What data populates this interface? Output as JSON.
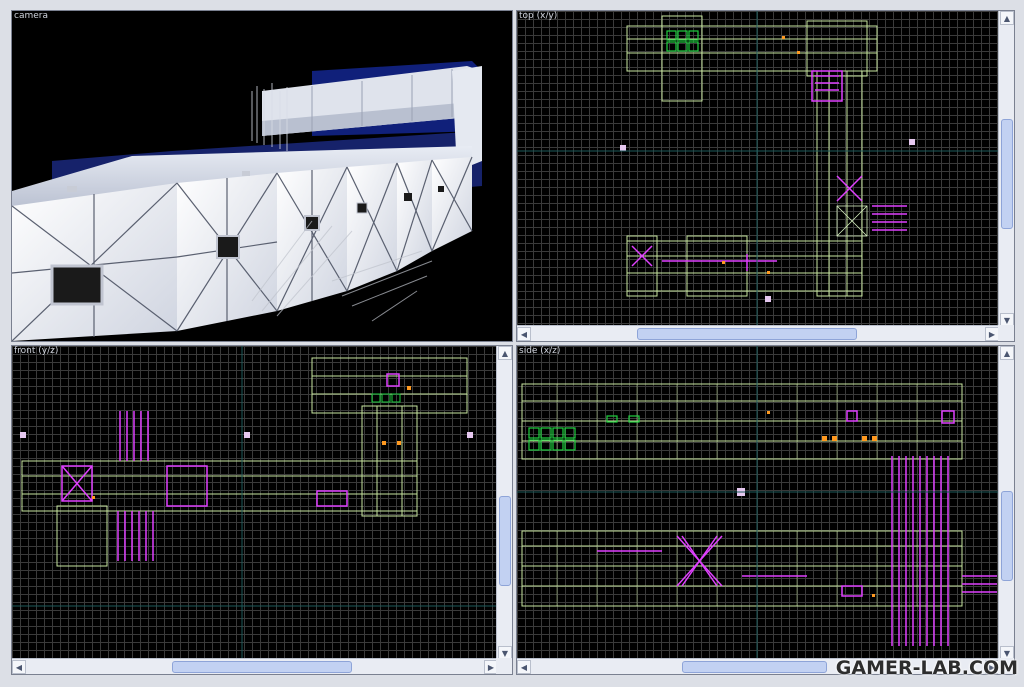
{
  "viewports": {
    "camera": {
      "label": "camera"
    },
    "top": {
      "label": "top (x/y)"
    },
    "front": {
      "label": "front (y/z)"
    },
    "side": {
      "label": "side (x/z)"
    }
  },
  "scrollbar": {
    "up": "▲",
    "down": "▼",
    "left": "◀",
    "right": "▶",
    "grip": "|||"
  },
  "watermark": {
    "text": "GAMER-LAB.COM"
  },
  "colors": {
    "background": "#dcdfe6",
    "grid": "#3a3a3a",
    "brush_outline": "#c8e6a0",
    "entity_magenta": "#e040ff",
    "selection_green": "#20d040",
    "entity_orange": "#ff9a20",
    "scroll_thumb": "#c2d1f2"
  }
}
